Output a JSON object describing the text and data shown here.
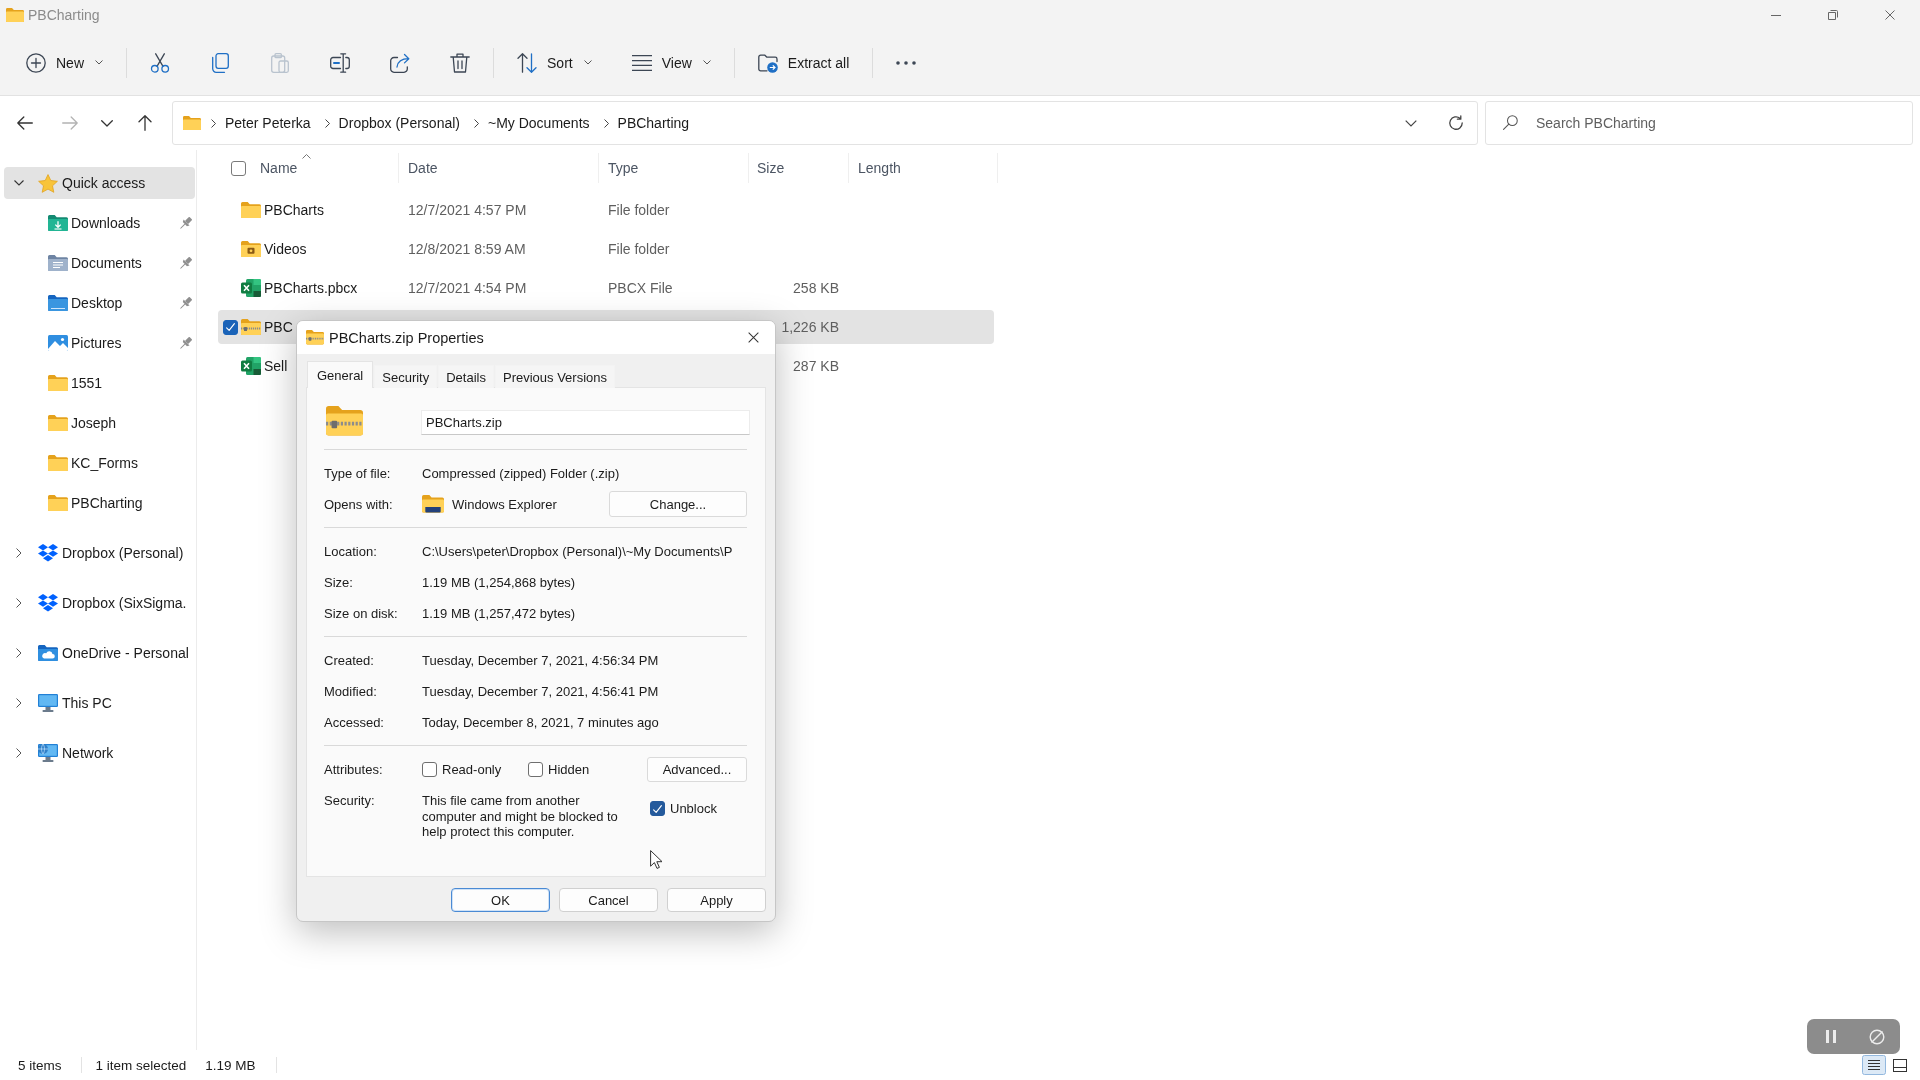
{
  "window": {
    "title": "PBCharting"
  },
  "toolbar": {
    "groups": [
      [
        {
          "kind": "new",
          "label": "New",
          "dropdown": true,
          "disabled": false
        }
      ],
      [
        {
          "kind": "cut",
          "disabled": false
        },
        {
          "kind": "copy",
          "disabled": false
        },
        {
          "kind": "paste",
          "disabled": true
        },
        {
          "kind": "rename",
          "disabled": false
        },
        {
          "kind": "share",
          "disabled": false
        },
        {
          "kind": "delete",
          "disabled": false
        }
      ],
      [
        {
          "kind": "sort",
          "label": "Sort",
          "dropdown": true,
          "disabled": false
        },
        {
          "kind": "view",
          "label": "View",
          "dropdown": true,
          "disabled": false
        }
      ],
      [
        {
          "kind": "extract",
          "label": "Extract all",
          "dropdown": false,
          "disabled": false
        }
      ],
      [
        {
          "kind": "more",
          "disabled": false
        }
      ]
    ]
  },
  "navigation_buttons": [
    {
      "kind": "back",
      "disabled": false
    },
    {
      "kind": "forward",
      "disabled": true
    },
    {
      "kind": "recent",
      "disabled": false
    },
    {
      "kind": "up",
      "disabled": false
    }
  ],
  "address_bar": {
    "path": [
      "Peter Peterka",
      "Dropbox (Personal)",
      "~My Documents",
      "PBCharting"
    ]
  },
  "search": {
    "placeholder": "Search PBCharting"
  },
  "sidebar": {
    "items": [
      {
        "kind": "star",
        "label": "Quick access",
        "expanded": true,
        "selected": true,
        "children": [
          {
            "kind": "downloads",
            "label": "Downloads",
            "pinned": true,
            "selected": false
          },
          {
            "kind": "documents",
            "label": "Documents",
            "pinned": true,
            "selected": false
          },
          {
            "kind": "desktop",
            "label": "Desktop",
            "pinned": true,
            "selected": false
          },
          {
            "kind": "pictures",
            "label": "Pictures",
            "pinned": true,
            "selected": false
          },
          {
            "kind": "folder",
            "label": "1551",
            "pinned": false,
            "selected": false
          },
          {
            "kind": "folder",
            "label": "Joseph",
            "pinned": false,
            "selected": false
          },
          {
            "kind": "folder",
            "label": "KC_Forms",
            "pinned": false,
            "selected": false
          },
          {
            "kind": "folder",
            "label": "PBCharting",
            "pinned": false,
            "selected": false
          }
        ]
      },
      {
        "kind": "dropbox",
        "label": "Dropbox (Personal)",
        "expanded": false,
        "selected": false
      },
      {
        "kind": "dropbox",
        "label": "Dropbox (SixSigma.",
        "expanded": false,
        "selected": false
      },
      {
        "kind": "onedrive",
        "label": "OneDrive - Personal",
        "expanded": false,
        "selected": false
      },
      {
        "kind": "pc",
        "label": "This PC",
        "expanded": false,
        "selected": false
      },
      {
        "kind": "network",
        "label": "Network",
        "expanded": false,
        "selected": false
      }
    ]
  },
  "file_list": {
    "select_all_checked": false,
    "columns": [
      {
        "label": "Name",
        "sorted": true
      },
      {
        "label": "Date",
        "sorted": false
      },
      {
        "label": "Type",
        "sorted": false
      },
      {
        "label": "Size",
        "sorted": false
      },
      {
        "label": "Length",
        "sorted": false
      }
    ],
    "rows": [
      {
        "kind": "folder",
        "name": "PBCharts",
        "date": "12/7/2021 4:57 PM",
        "type": "File folder",
        "selected": false
      },
      {
        "kind": "film",
        "name": "Videos",
        "date": "12/8/2021 8:59 AM",
        "type": "File folder",
        "selected": false
      },
      {
        "kind": "excel",
        "name": "PBCharts.pbcx",
        "date": "12/7/2021 4:54 PM",
        "type": "PBCX File",
        "size": "258 KB",
        "selected": false
      },
      {
        "kind": "zip",
        "name": "PBC",
        "size": "1,226 KB",
        "selected": true
      },
      {
        "kind": "excel",
        "name": "Sell",
        "size": "287 KB",
        "selected": false
      }
    ]
  },
  "status_bar": {
    "item_count": "5 items",
    "selection": "1 item selected",
    "selection_size": "1.19 MB",
    "views": [
      {
        "kind": "details",
        "selected": true
      },
      {
        "kind": "tiles",
        "selected": false
      }
    ]
  },
  "dialog": {
    "title": "PBCharts.zip Properties",
    "tabs": [
      {
        "label": "General",
        "selected": true
      },
      {
        "label": "Security",
        "selected": false
      },
      {
        "label": "Details",
        "selected": false
      },
      {
        "label": "Previous Versions",
        "selected": false
      }
    ],
    "file_name": "PBCharts.zip",
    "sections": [
      [
        {
          "kind": "text",
          "label": "Type of file:",
          "value": "Compressed (zipped) Folder (.zip)"
        },
        {
          "kind": "app",
          "label": "Opens with:",
          "value": "Windows Explorer",
          "button": "Change..."
        }
      ],
      [
        {
          "kind": "text",
          "label": "Location:",
          "value": "C:\\Users\\peter\\Dropbox (Personal)\\~My Documents\\P"
        },
        {
          "kind": "text",
          "label": "Size:",
          "value": "1.19 MB (1,254,868 bytes)"
        },
        {
          "kind": "text",
          "label": "Size on disk:",
          "value": "1.19 MB (1,257,472 bytes)"
        }
      ],
      [
        {
          "kind": "text",
          "label": "Created:",
          "value": "Tuesday, December 7, 2021, 4:56:34 PM"
        },
        {
          "kind": "text",
          "label": "Modified:",
          "value": "Tuesday, December 7, 2021, 4:56:41 PM"
        },
        {
          "kind": "text",
          "label": "Accessed:",
          "value": "Today, December 8, 2021, 7 minutes ago"
        }
      ]
    ],
    "attributes": {
      "label": "Attributes:",
      "options": [
        {
          "label": "Read-only",
          "checked": false
        },
        {
          "label": "Hidden",
          "checked": false
        }
      ],
      "button": "Advanced..."
    },
    "security": {
      "label": "Security:",
      "text": "This file came from another computer and might be blocked to help protect this computer.",
      "unblock": {
        "label": "Unblock",
        "checked": true
      }
    },
    "buttons": [
      {
        "label": "OK",
        "default": true
      },
      {
        "label": "Cancel",
        "default": false
      },
      {
        "label": "Apply",
        "default": false
      }
    ]
  }
}
